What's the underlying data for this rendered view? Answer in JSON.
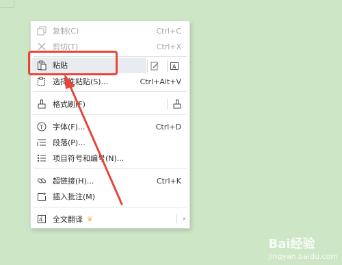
{
  "menu": {
    "items": [
      {
        "label": "复制(C)",
        "shortcut": "Ctrl+C",
        "icon": "copy-icon",
        "disabled": true
      },
      {
        "label": "剪切(T)",
        "shortcut": "Ctrl+X",
        "icon": "cut-icon",
        "disabled": true
      },
      {
        "label": "粘贴",
        "shortcut": "",
        "icon": "paste-icon",
        "disabled": false
      },
      {
        "label": "选择性粘贴(S)...",
        "shortcut": "Ctrl+Alt+V",
        "icon": "paste-special-icon",
        "disabled": false
      },
      {
        "label": "格式刷(F)",
        "shortcut": "",
        "icon": "format-painter-icon",
        "disabled": false
      },
      {
        "label": "字体(F)...",
        "shortcut": "Ctrl+D",
        "icon": "font-icon",
        "disabled": false
      },
      {
        "label": "段落(P)...",
        "shortcut": "",
        "icon": "paragraph-icon",
        "disabled": false
      },
      {
        "label": "项目符号和编号(N)...",
        "shortcut": "",
        "icon": "bullets-icon",
        "disabled": false
      },
      {
        "label": "超链接(H)...",
        "shortcut": "Ctrl+K",
        "icon": "link-icon",
        "disabled": false
      },
      {
        "label": "插入批注(M)",
        "shortcut": "",
        "icon": "comment-icon",
        "disabled": false
      },
      {
        "label": "全文翻译",
        "shortcut": "",
        "icon": "translate-icon",
        "disabled": false
      }
    ]
  },
  "watermark": {
    "text": "Bai经验",
    "sub": "jingyan.baidu.com"
  },
  "colors": {
    "highlight": "#e8443a",
    "background": "#cde6c6",
    "crown": "#f2b94a"
  }
}
